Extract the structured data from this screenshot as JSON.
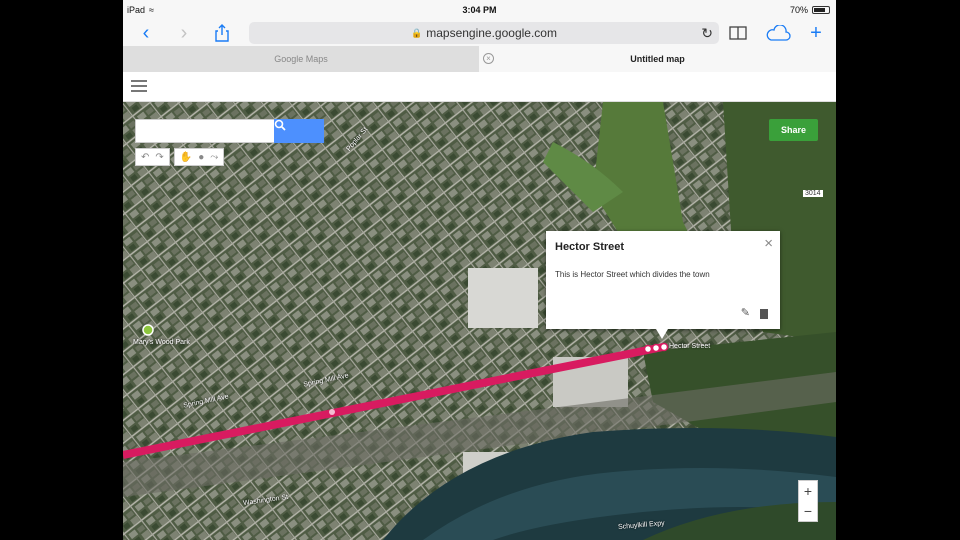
{
  "status": {
    "device": "iPad",
    "time": "3:04 PM",
    "battery": "70%"
  },
  "browser": {
    "url": "mapsengine.google.com",
    "tabs": [
      {
        "label": "Google Maps",
        "active": false
      },
      {
        "label": "Untitled map",
        "active": true
      }
    ]
  },
  "map": {
    "share_label": "Share",
    "search": {
      "value": ""
    },
    "popup": {
      "title": "Hector Street",
      "description": "This is Hector Street which divides the town"
    },
    "zoom": {
      "in": "+",
      "out": "−"
    },
    "street_labels": [
      "Hector Street",
      "Spring Mill Ave",
      "Washington St",
      "Schuylkill Expy",
      "Mary's Wood Park",
      "Spring Mill Ave",
      "Poplar St",
      "3014"
    ],
    "colors": {
      "route": "#d81b60",
      "share": "#3aa03a",
      "search_button": "#4d90fe"
    }
  },
  "icons": {
    "back": "chevron-left-icon",
    "forward": "chevron-right-icon",
    "share": "share-icon",
    "bookmarks": "book-icon",
    "cloud": "cloud-icon",
    "new_tab": "plus-icon"
  }
}
